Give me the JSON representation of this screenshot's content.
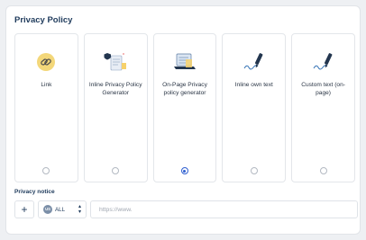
{
  "panel": {
    "title": "Privacy Policy"
  },
  "options": [
    {
      "label": "Link",
      "icon": "link-icon",
      "selected": false
    },
    {
      "label": "Inline Privacy Policy Generator",
      "icon": "document-generator-icon",
      "selected": false
    },
    {
      "label": "On-Page Privacy policy generator",
      "icon": "laptop-document-icon",
      "selected": true
    },
    {
      "label": "Inline own text",
      "icon": "pen-signature-icon",
      "selected": false
    },
    {
      "label": "Custom text (on-page)",
      "icon": "pen-signature-icon",
      "selected": false
    }
  ],
  "notice": {
    "label": "Privacy notice",
    "add_label": "+",
    "language": {
      "flag_text": "US",
      "value": "ALL"
    },
    "url": {
      "value": "",
      "placeholder": "https://www."
    }
  },
  "colors": {
    "accent": "#2f5fd0",
    "link_icon_bg": "#f3d77a",
    "heading": "#1f3b5c"
  }
}
